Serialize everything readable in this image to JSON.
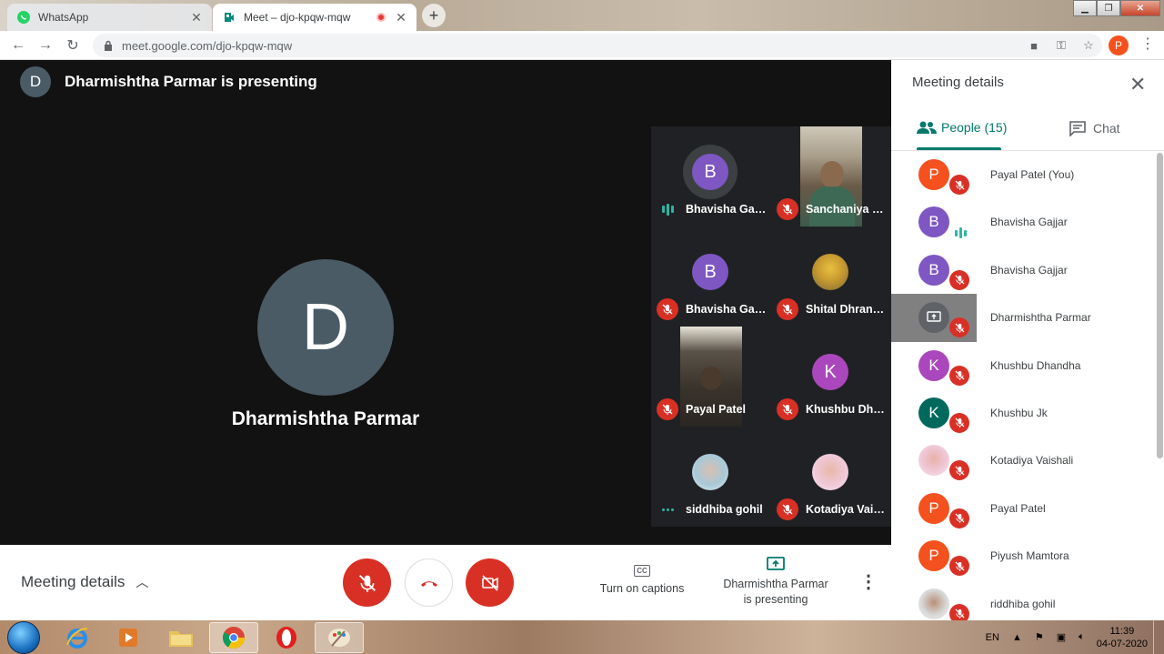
{
  "browser": {
    "tabs": [
      {
        "title": "WhatsApp",
        "active": false
      },
      {
        "title": "Meet – djo-kpqw-mqw",
        "active": true,
        "recording": true
      }
    ],
    "url": "meet.google.com/djo-kpqw-mqw",
    "profile_initial": "P"
  },
  "stage": {
    "presenter_initial": "D",
    "presenting_text": "Dharmishtha Parmar is presenting",
    "main_initial": "D",
    "main_name": "Dharmishtha Parmar"
  },
  "tiles": [
    {
      "name": "Bhavisha Gajjar",
      "initial": "B",
      "color": "#7e57c2",
      "status": "speaking",
      "kind": "avatar",
      "ring": true
    },
    {
      "name": "Sanchaniya K...",
      "status": "muted",
      "kind": "video"
    },
    {
      "name": "Bhavisha Gajjar",
      "initial": "B",
      "color": "#7e57c2",
      "status": "muted",
      "kind": "avatar"
    },
    {
      "name": "Shital Dhrang...",
      "status": "muted",
      "kind": "photo"
    },
    {
      "name": "Payal Patel",
      "status": "muted",
      "kind": "video"
    },
    {
      "name": "Khushbu Dha...",
      "initial": "K",
      "color": "#ab47bc",
      "status": "muted",
      "kind": "avatar"
    },
    {
      "name": "siddhiba gohil",
      "status": "dots",
      "kind": "photo"
    },
    {
      "name": "Kotadiya Vais...",
      "status": "muted",
      "kind": "photo"
    }
  ],
  "controls": {
    "meeting_details_label": "Meeting details",
    "captions_label": "Turn on captions",
    "captions_icon": "CC",
    "present_line1": "Dharmishtha Parmar",
    "present_line2": "is presenting"
  },
  "panel": {
    "title": "Meeting details",
    "people_tab": "People (15)",
    "chat_tab": "Chat",
    "people": [
      {
        "name": "Payal Patel (You)",
        "initial": "P",
        "color": "#f4511e",
        "status": "muted"
      },
      {
        "name": "Bhavisha Gajjar",
        "initial": "B",
        "color": "#7e57c2",
        "status": "speaking"
      },
      {
        "name": "Bhavisha Gajjar",
        "initial": "B",
        "color": "#7e57c2",
        "status": "muted"
      },
      {
        "name": "Dharmishtha Parmar",
        "initial": "",
        "color": "#5f6368",
        "status": "muted",
        "presenting": true
      },
      {
        "name": "Khushbu Dhandha",
        "initial": "K",
        "color": "#ab47bc",
        "status": "muted"
      },
      {
        "name": "Khushbu Jk",
        "initial": "K",
        "color": "#00695c",
        "status": "muted"
      },
      {
        "name": "Kotadiya Vaishali",
        "initial": "",
        "color": "#e8c4c4",
        "status": "muted",
        "photo": true
      },
      {
        "name": "Payal Patel",
        "initial": "P",
        "color": "#f4511e",
        "status": "muted"
      },
      {
        "name": "Piyush Mamtora",
        "initial": "P",
        "color": "#f4511e",
        "status": "muted"
      },
      {
        "name": "riddhiba gohil",
        "initial": "",
        "color": "#c9c9c9",
        "status": "muted",
        "photo": true
      }
    ]
  },
  "taskbar": {
    "lang": "EN",
    "time": "11:39",
    "date": "04-07-2020"
  }
}
